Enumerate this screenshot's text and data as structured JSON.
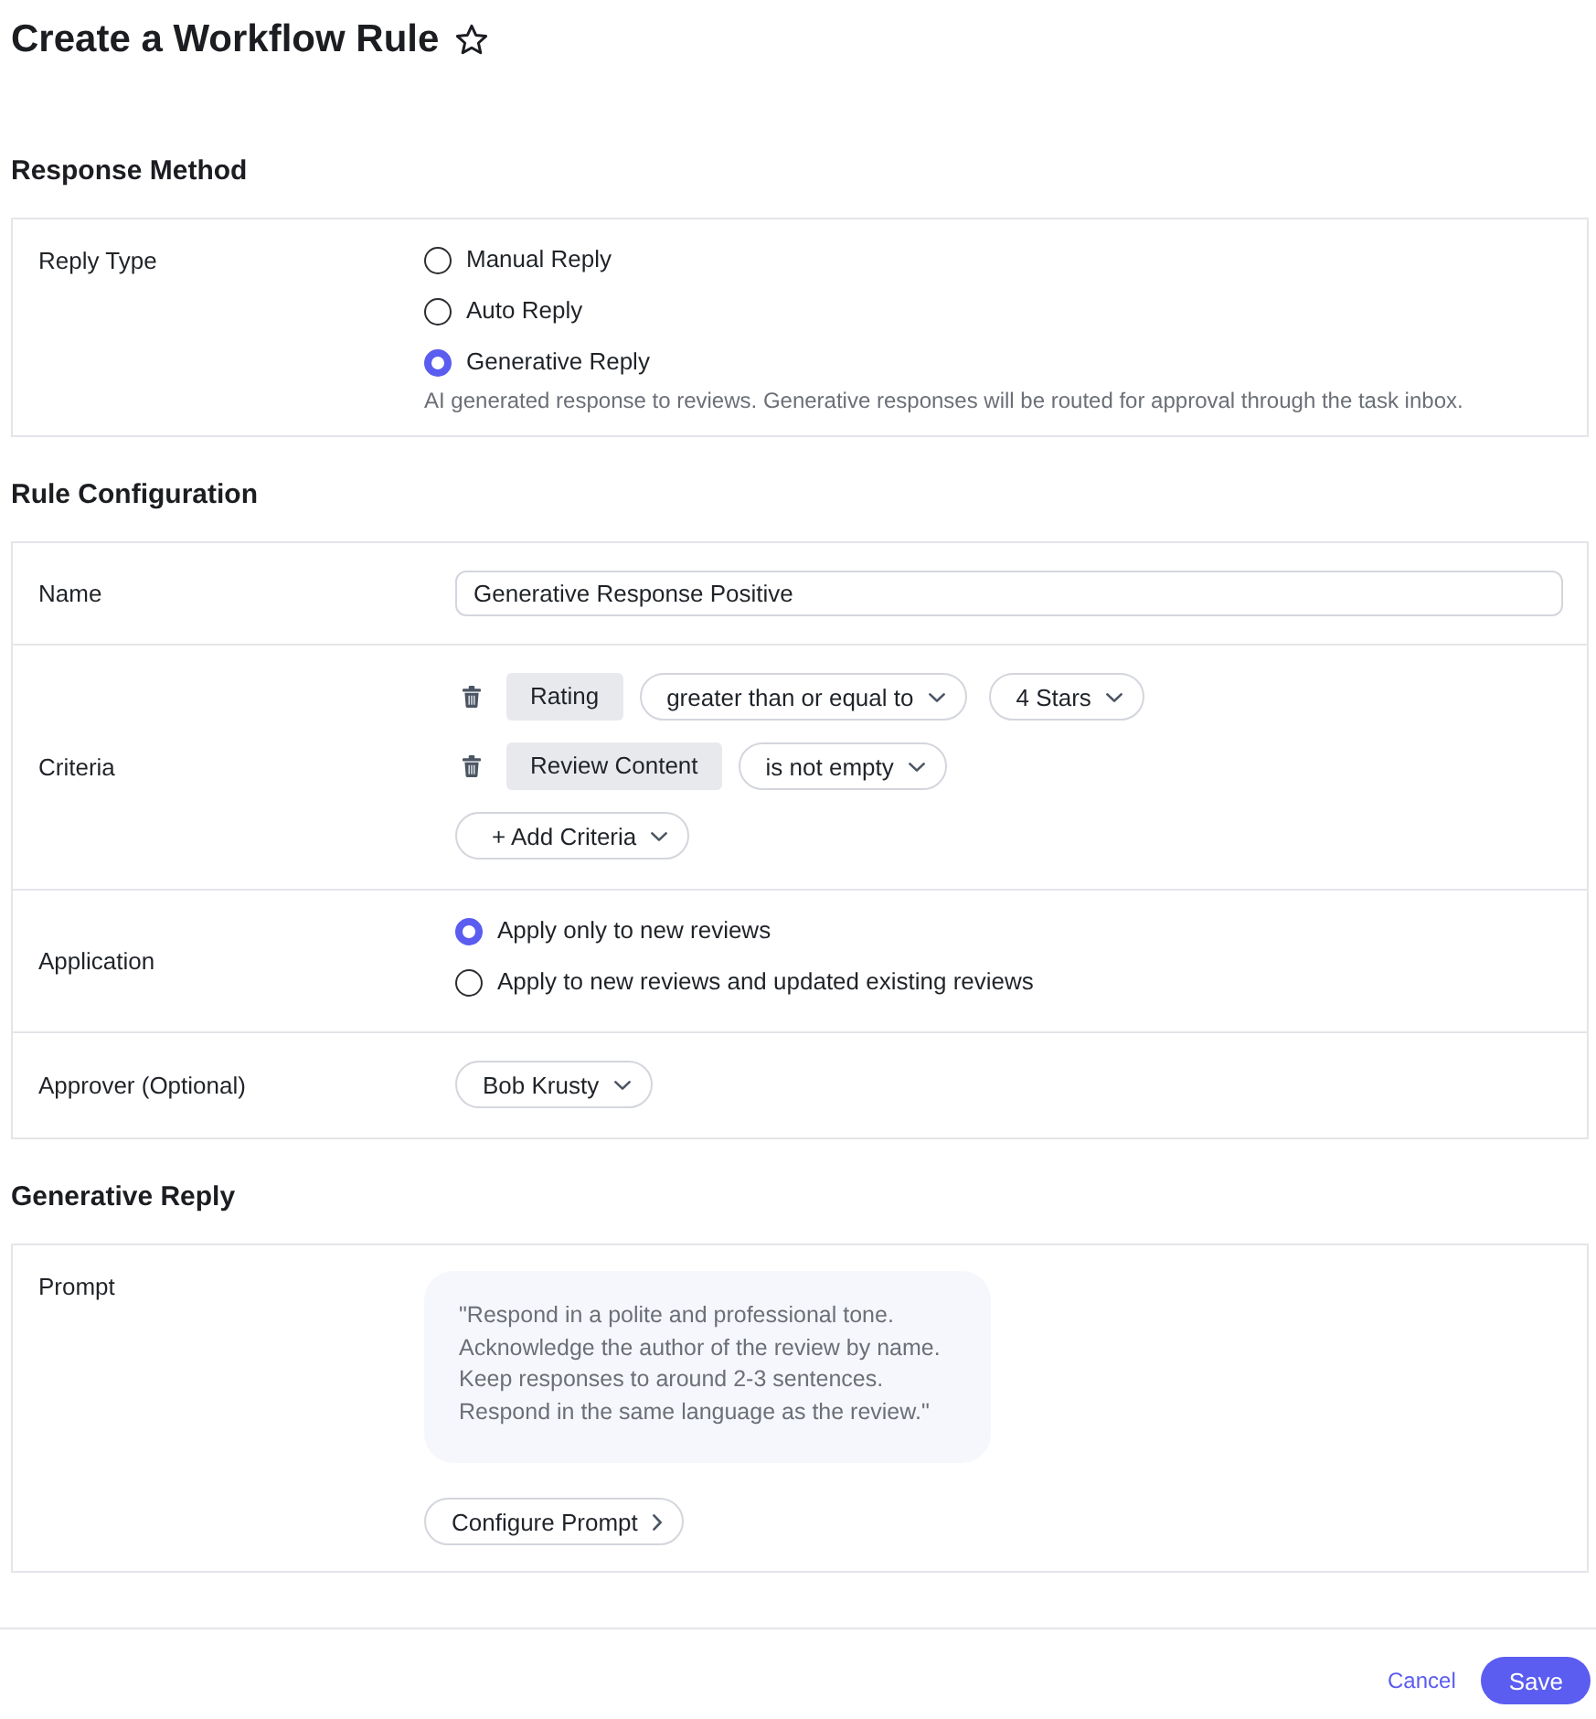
{
  "header": {
    "title": "Create a Workflow Rule",
    "starred": false
  },
  "response_method": {
    "heading": "Response Method",
    "reply_type": {
      "label": "Reply Type",
      "options": [
        {
          "label": "Manual Reply",
          "selected": false
        },
        {
          "label": "Auto Reply",
          "selected": false
        },
        {
          "label": "Generative Reply",
          "selected": true
        }
      ],
      "help": "AI generated response to reviews. Generative responses will be routed for approval through the task inbox."
    }
  },
  "rule_configuration": {
    "heading": "Rule Configuration",
    "name": {
      "label": "Name",
      "value": "Generative Response Positive"
    },
    "criteria": {
      "label": "Criteria",
      "rows": [
        {
          "field": "Rating",
          "operator": "greater than or equal to",
          "value": "4 Stars"
        },
        {
          "field": "Review Content",
          "operator": "is not empty"
        }
      ],
      "add_button": "+ Add Criteria"
    },
    "application": {
      "label": "Application",
      "options": [
        {
          "label": "Apply only to new reviews",
          "selected": true
        },
        {
          "label": "Apply to new reviews and updated existing reviews",
          "selected": false
        }
      ]
    },
    "approver": {
      "label": "Approver (Optional)",
      "value": "Bob Krusty"
    }
  },
  "generative_reply": {
    "heading": "Generative Reply",
    "prompt": {
      "label": "Prompt",
      "text": "\"Respond in a polite and professional tone.\nAcknowledge the author of the review by name.\nKeep responses to around 2-3 sentences.\nRespond in the same language as the review.\"",
      "button": "Configure Prompt"
    }
  },
  "footer": {
    "cancel": "Cancel",
    "save": "Save"
  }
}
